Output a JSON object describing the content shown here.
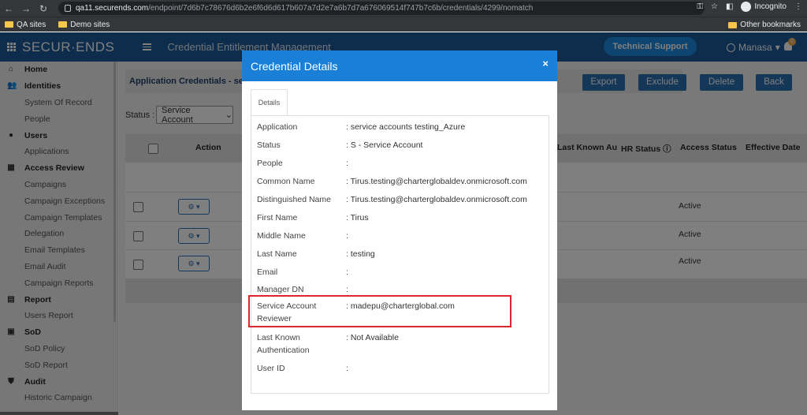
{
  "browser": {
    "url_domain": "qa11.securends.com",
    "url_path": "/endpoint/7d6b7c78676d6b2e6f6d6d617b607a7d2e7a6b7d7a676069514f747b7c6b/credentials/4299/nomatch",
    "mode": "Incognito",
    "bookmarks": [
      "QA sites",
      "Demo sites"
    ],
    "other_bookmarks": "Other bookmarks"
  },
  "header": {
    "logo": "SECUR·ENDS",
    "title": "Credential Entitlement Management",
    "support_button": "Technical Support",
    "user": "Manasa",
    "notification_count": "0"
  },
  "sidebar": {
    "items": [
      {
        "label": "Home",
        "type": "section",
        "icon": "⌂"
      },
      {
        "label": "Identities",
        "type": "section",
        "icon": "👥"
      },
      {
        "label": "System Of Record",
        "type": "sub"
      },
      {
        "label": "People",
        "type": "sub"
      },
      {
        "label": "Users",
        "type": "section",
        "icon": "●"
      },
      {
        "label": "Applications",
        "type": "sub"
      },
      {
        "label": "Access Review",
        "type": "section",
        "icon": "▦"
      },
      {
        "label": "Campaigns",
        "type": "sub"
      },
      {
        "label": "Campaign Exceptions",
        "type": "sub"
      },
      {
        "label": "Campaign Templates",
        "type": "sub"
      },
      {
        "label": "Delegation",
        "type": "sub"
      },
      {
        "label": "Email Templates",
        "type": "sub"
      },
      {
        "label": "Email Audit",
        "type": "sub"
      },
      {
        "label": "Campaign Reports",
        "type": "sub"
      },
      {
        "label": "Report",
        "type": "section",
        "icon": "▤"
      },
      {
        "label": "Users Report",
        "type": "sub"
      },
      {
        "label": "SoD",
        "type": "section",
        "icon": "▣"
      },
      {
        "label": "SoD Policy",
        "type": "sub"
      },
      {
        "label": "SoD Report",
        "type": "sub"
      },
      {
        "label": "Audit",
        "type": "section",
        "icon": "⛊"
      },
      {
        "label": "Historic Campaign",
        "type": "sub"
      }
    ]
  },
  "main": {
    "breadcrumb": "Application Credentials - serv",
    "buttons": {
      "export": "Export",
      "exclude": "Exclude",
      "delete": "Delete",
      "back": "Back"
    },
    "status_label": "Status :",
    "status_value": "Service Account",
    "columns": {
      "action": "Action",
      "last_known": "Last Known Au",
      "hr_status": "HR Status",
      "access_status": "Access Status",
      "effective_date": "Effective Date"
    },
    "rows": [
      {
        "access_status": "Active"
      },
      {
        "access_status": "Active"
      },
      {
        "access_status": "Active"
      }
    ]
  },
  "modal": {
    "title": "Credential Details",
    "close": "×",
    "tab": "Details",
    "fields": [
      {
        "label": "Application",
        "value": ": service accounts testing_Azure"
      },
      {
        "label": "Status",
        "value": ": S - Service Account"
      },
      {
        "label": "People",
        "value": ":"
      },
      {
        "label": "Common Name",
        "value": ": Tirus.testing@charterglobaldev.onmicrosoft.com"
      },
      {
        "label": "Distinguished Name",
        "value": ": Tirus.testing@charterglobaldev.onmicrosoft.com"
      },
      {
        "label": "First Name",
        "value": ": Tirus"
      },
      {
        "label": "Middle Name",
        "value": ":"
      },
      {
        "label": "Last Name",
        "value": ": testing"
      },
      {
        "label": "Email",
        "value": ":"
      },
      {
        "label": "Manager DN",
        "value": ":"
      },
      {
        "label": "Service Account Reviewer",
        "value": ": madepu@charterglobal.com"
      },
      {
        "label": "Last Known Authentication",
        "value": ": Not Available"
      },
      {
        "label": "User ID",
        "value": ":"
      }
    ]
  },
  "colors": {
    "header_blue": "#1c5b98",
    "modal_blue": "#1a7fd6",
    "highlight_red": "#e0242a",
    "button_blue": "#2a6fb1"
  }
}
